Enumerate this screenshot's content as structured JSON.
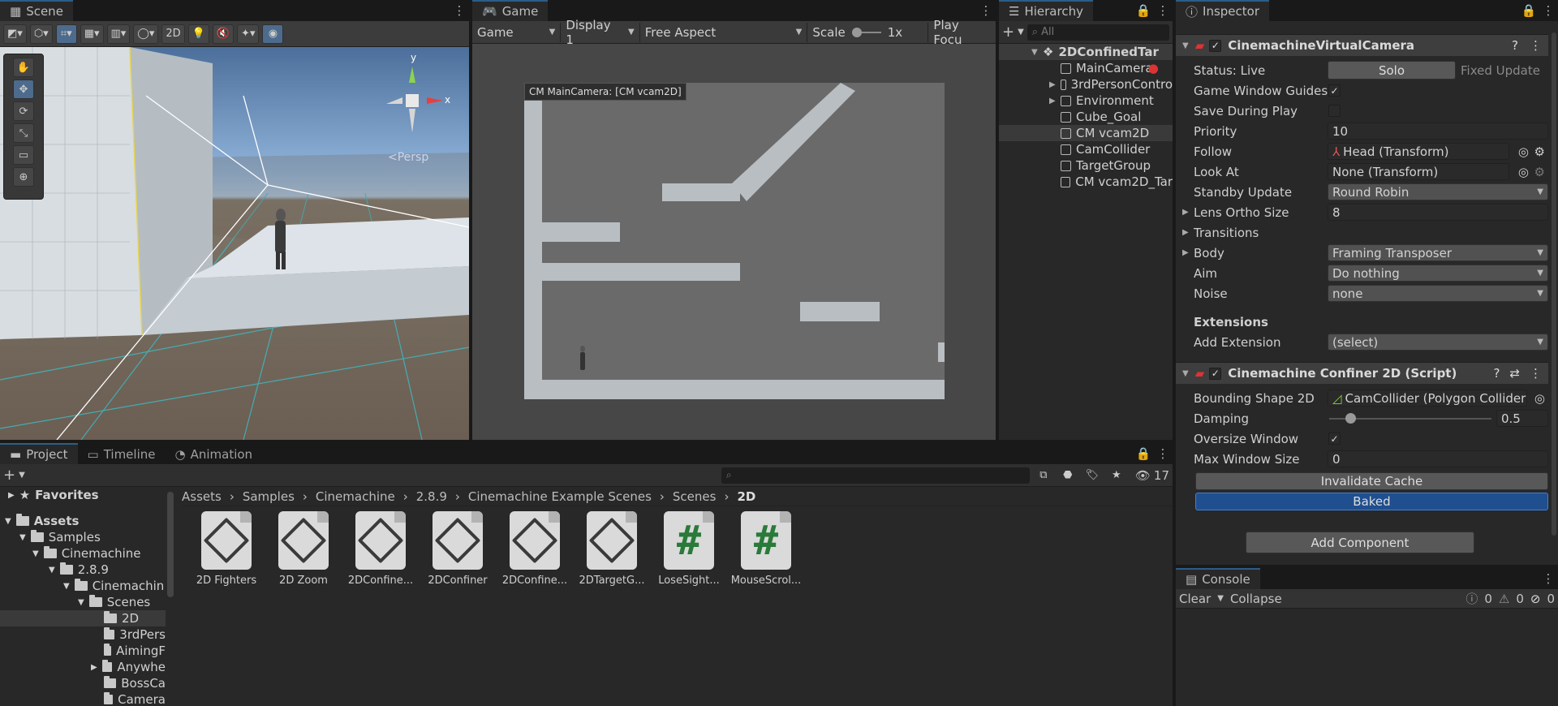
{
  "scene": {
    "tab": "Scene",
    "mode2d": "2D",
    "persp": "<Persp",
    "axis_y": "y",
    "axis_x": "x"
  },
  "game": {
    "tab": "Game",
    "mode": "Game",
    "display": "Display 1",
    "aspect": "Free Aspect",
    "scale_label": "Scale",
    "scale_value": "1x",
    "play_focus": "Play Focu",
    "overlay": "CM MainCamera: [CM vcam2D]"
  },
  "hierarchy": {
    "tab": "Hierarchy",
    "search_placeholder": "All",
    "root": "2DConfinedTar",
    "items": [
      "MainCamera",
      "3rdPersonContro",
      "Environment",
      "Cube_Goal",
      "CM vcam2D",
      "CamCollider",
      "TargetGroup",
      "CM vcam2D_Tar"
    ]
  },
  "inspector": {
    "tab": "Inspector",
    "vcam": {
      "title": "CinemachineVirtualCamera",
      "status_label": "Status: Live",
      "solo": "Solo",
      "fixed_update": "Fixed Update",
      "game_window_guides": "Game Window Guides",
      "save_during_play": "Save During Play",
      "priority_label": "Priority",
      "priority": "10",
      "follow_label": "Follow",
      "follow": "Head (Transform)",
      "lookat_label": "Look At",
      "lookat": "None (Transform)",
      "standby_label": "Standby Update",
      "standby": "Round Robin",
      "lens_label": "Lens Ortho Size",
      "lens": "8",
      "transitions": "Transitions",
      "body_label": "Body",
      "body": "Framing Transposer",
      "aim_label": "Aim",
      "aim": "Do nothing",
      "noise_label": "Noise",
      "noise": "none",
      "extensions": "Extensions",
      "add_ext_label": "Add Extension",
      "add_ext": "(select)"
    },
    "confiner": {
      "title": "Cinemachine Confiner 2D (Script)",
      "shape_label": "Bounding Shape 2D",
      "shape": "CamCollider (Polygon Collider",
      "damping_label": "Damping",
      "damping": "0.5",
      "damping_fraction": 0.1,
      "oversize_label": "Oversize Window",
      "maxsize_label": "Max Window Size",
      "maxsize": "0",
      "invalidate": "Invalidate Cache",
      "baked": "Baked"
    },
    "add_component": "Add Component"
  },
  "console": {
    "tab": "Console",
    "clear": "Clear",
    "collapse": "Collapse",
    "logs": "0",
    "warnings": "0",
    "errors": "0"
  },
  "project": {
    "tabs": [
      "Project",
      "Timeline",
      "Animation"
    ],
    "hidden_count": "17",
    "breadcrumb": [
      "Assets",
      "Samples",
      "Cinemachine",
      "2.8.9",
      "Cinemachine Example Scenes",
      "Scenes",
      "2D"
    ],
    "favorites": "Favorites",
    "tree": [
      "Assets",
      "Samples",
      "Cinemachine",
      "2.8.9",
      "Cinemachin",
      "Scenes",
      "2D",
      "3rdPers",
      "AimingF",
      "Anywhe",
      "BossCa",
      "Camera"
    ],
    "assets": [
      "2D Fighters",
      "2D Zoom",
      "2DConfine...",
      "2DConfiner",
      "2DConfine...",
      "2DTargetG...",
      "LoseSight...",
      "MouseScrol..."
    ]
  },
  "colors": {
    "accent": "#2c5d87",
    "baked": "#1f4f8f",
    "green_hash": "#2a7a3a"
  }
}
